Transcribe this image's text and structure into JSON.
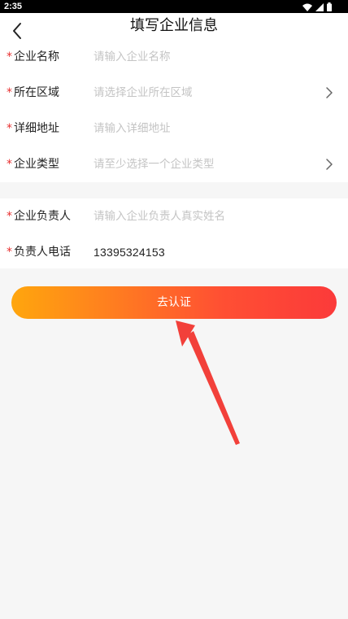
{
  "status_bar": {
    "time": "2:35",
    "icons": [
      "wifi-icon",
      "signal-icon",
      "battery-icon"
    ]
  },
  "header": {
    "title": "填写企业信息",
    "back_icon": "chevron-left-icon"
  },
  "form": {
    "required_mark": "*",
    "company_name": {
      "label": "企业名称",
      "placeholder": "请输入企业名称",
      "value": ""
    },
    "region": {
      "label": "所在区域",
      "placeholder": "请选择企业所在区域",
      "value": ""
    },
    "address": {
      "label": "详细地址",
      "placeholder": "请输入详细地址",
      "value": ""
    },
    "company_type": {
      "label": "企业类型",
      "placeholder": "请至少选择一个企业类型",
      "value": ""
    },
    "responsible_person": {
      "label": "企业负责人",
      "placeholder": "请输入企业负责人真实姓名",
      "value": ""
    },
    "phone": {
      "label": "负责人电话",
      "value": "13395324153"
    }
  },
  "submit_label": "去认证",
  "colors": {
    "required": "#e83030",
    "gradient_start": "#ffa60d",
    "gradient_end": "#fb3a3a",
    "annotation_arrow": "#f2403a"
  }
}
